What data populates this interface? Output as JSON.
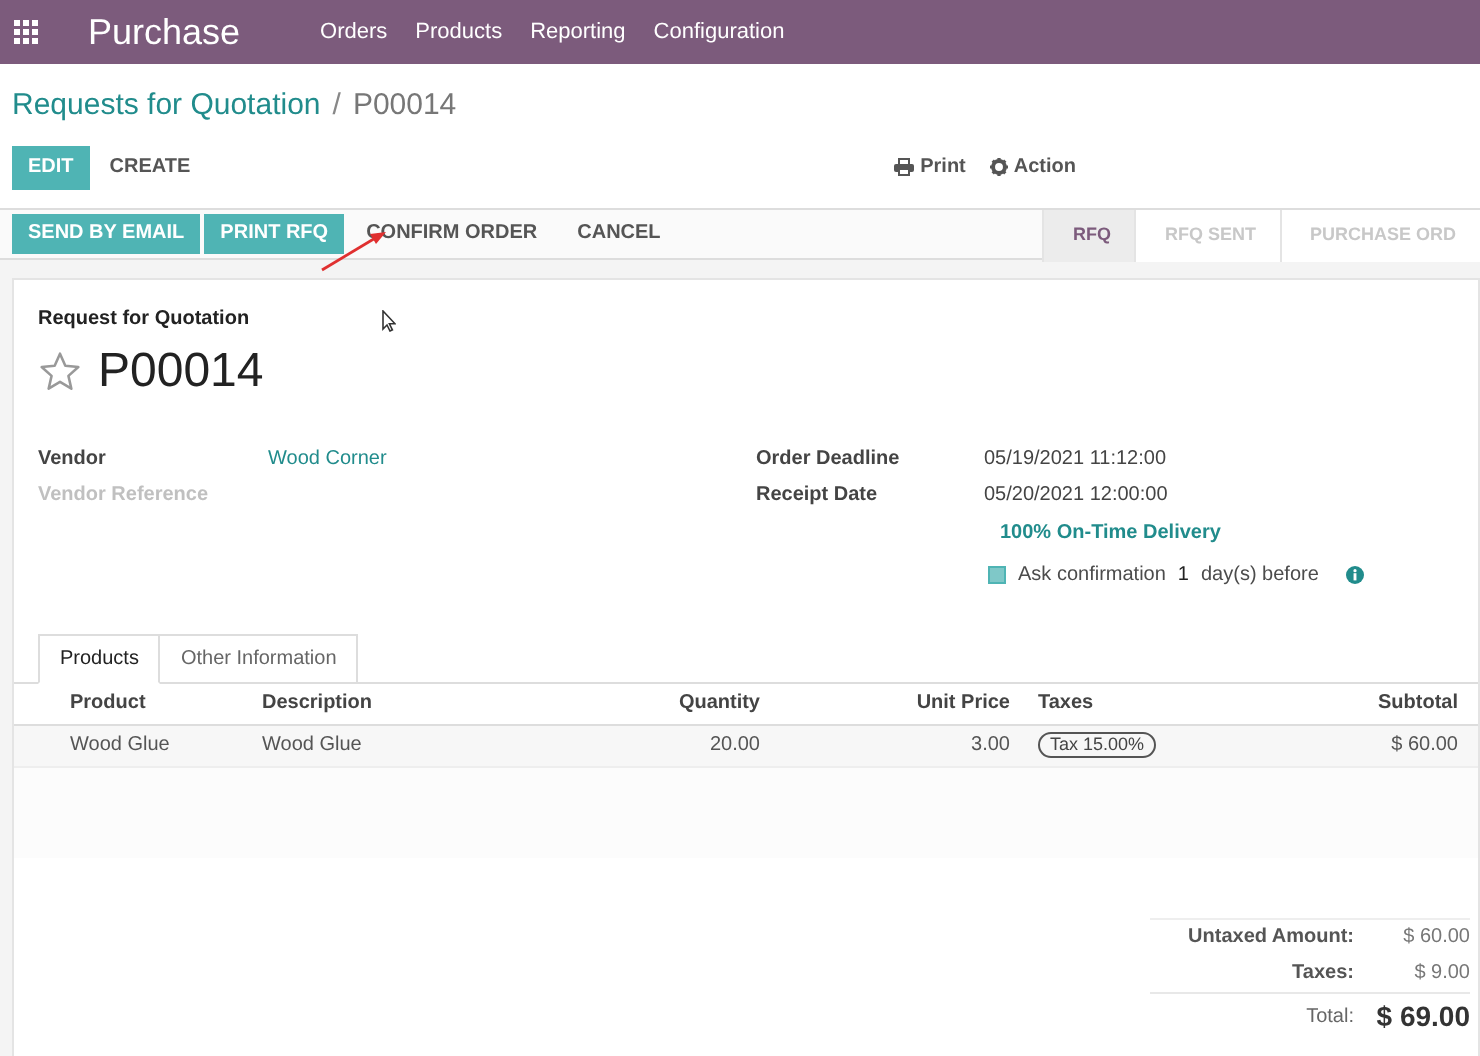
{
  "navbar": {
    "app": "Purchase",
    "menu": [
      "Orders",
      "Products",
      "Reporting",
      "Configuration"
    ]
  },
  "breadcrumb": {
    "parent": "Requests for Quotation",
    "separator": "/",
    "current": "P00014"
  },
  "actions": {
    "primary": "EDIT",
    "secondary": "CREATE",
    "print": "Print",
    "action": "Action"
  },
  "header_buttons": [
    {
      "label": "SEND BY EMAIL",
      "kind": "primary"
    },
    {
      "label": "PRINT RFQ",
      "kind": "primary"
    },
    {
      "label": "CONFIRM ORDER",
      "kind": "plain"
    },
    {
      "label": "CANCEL",
      "kind": "plain"
    }
  ],
  "stages": [
    {
      "label": "RFQ",
      "selected": true
    },
    {
      "label": "RFQ SENT",
      "selected": false
    },
    {
      "label": "PURCHASE ORD",
      "selected": false
    }
  ],
  "sheet": {
    "subtitle": "Request for Quotation",
    "name": "P00014",
    "starred": false,
    "left_fields": [
      {
        "label": "Vendor",
        "value": "Wood Corner",
        "muted": false
      },
      {
        "label": "Vendor Reference",
        "muted": true
      }
    ],
    "right_fields": [
      {
        "label": "Order Deadline",
        "value": "05/19/2021 11:12:00"
      },
      {
        "label": "Receipt Date",
        "value": "05/20/2021 12:00:00"
      }
    ],
    "on_time": "100% On-Time Delivery",
    "confirmation": {
      "checked": true,
      "label": "Ask confirmation",
      "days": "1",
      "suffix": "day(s) before"
    }
  },
  "tabs": [
    {
      "label": "Products",
      "selected": true
    },
    {
      "label": "Other Information",
      "selected": false
    }
  ],
  "table": {
    "columns": [
      "Product",
      "Description",
      "Quantity",
      "Unit Price",
      "Taxes",
      "Subtotal"
    ],
    "rows": [
      {
        "product": "Wood Glue",
        "description": "Wood Glue",
        "quantity": "20.00",
        "unit_price": "3.00",
        "taxes": "Tax 15.00%",
        "subtotal": "$ 60.00"
      }
    ]
  },
  "totals": [
    {
      "label": "Untaxed Amount:",
      "value": "$ 60.00",
      "kind": "line"
    },
    {
      "label": "Taxes:",
      "value": "$ 9.00",
      "kind": "line"
    },
    {
      "label": "Total:",
      "value": "$ 69.00",
      "kind": "total"
    }
  ]
}
